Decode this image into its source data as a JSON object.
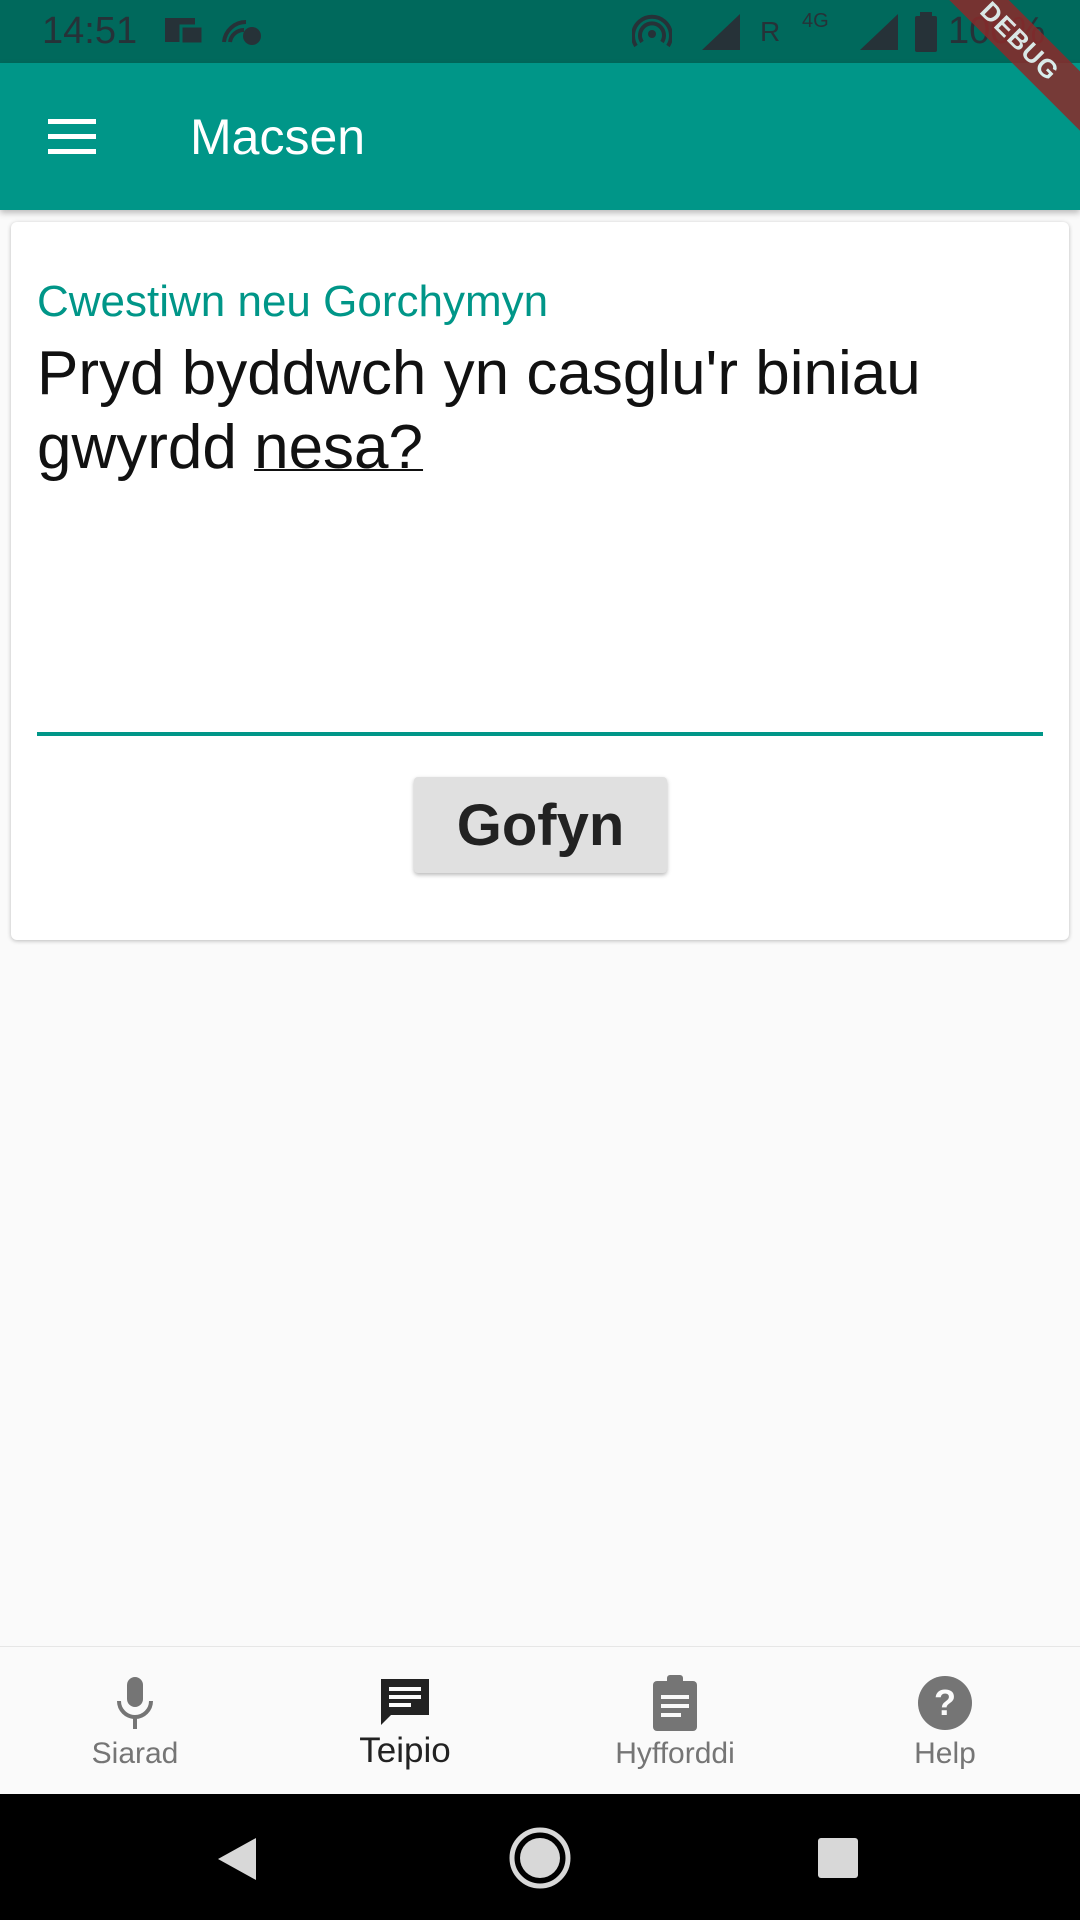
{
  "status_bar": {
    "time": "14:51",
    "network": "R",
    "network_type": "4G",
    "battery": "100%"
  },
  "app_bar": {
    "title": "Macsen",
    "debug_banner": "DEBUG"
  },
  "input": {
    "label": "Cwestiwn neu Gorchymyn",
    "value_part1": "Pryd byddwch yn casglu'r biniau gwyrdd ",
    "value_part2": "nesa?"
  },
  "ask_button": {
    "label": "Gofyn"
  },
  "bottom_nav": {
    "items": [
      {
        "label": "Siarad",
        "icon": "microphone-icon",
        "active": false
      },
      {
        "label": "Teipio",
        "icon": "message-icon",
        "active": true
      },
      {
        "label": "Hyfforddi",
        "icon": "clipboard-icon",
        "active": false
      },
      {
        "label": "Help",
        "icon": "help-icon",
        "active": false
      }
    ]
  },
  "colors": {
    "primary": "#009688",
    "status_bar": "#00695c",
    "debug": "#8b2a2a"
  }
}
